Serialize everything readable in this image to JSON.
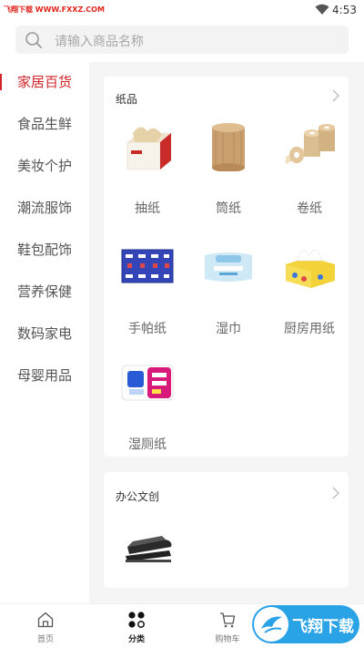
{
  "status_bar": {
    "watermark": "飞翔下载 WWW.FXXZ.COM",
    "time": "4:53"
  },
  "search": {
    "placeholder": "请输入商品名称"
  },
  "sidebar": {
    "items": [
      {
        "label": "家居百货",
        "active": true
      },
      {
        "label": "食品生鲜"
      },
      {
        "label": "美妆个护"
      },
      {
        "label": "潮流服饰"
      },
      {
        "label": "鞋包配饰"
      },
      {
        "label": "营养保健"
      },
      {
        "label": "数码家电"
      },
      {
        "label": "母婴用品"
      }
    ]
  },
  "sections": [
    {
      "title": "纸品",
      "items": [
        {
          "label": "抽纸",
          "icon": "tissue-box-icon"
        },
        {
          "label": "筒纸",
          "icon": "toilet-roll-icon"
        },
        {
          "label": "卷纸",
          "icon": "paper-rolls-icon"
        },
        {
          "label": "手帕纸",
          "icon": "pocket-tissue-pack-icon"
        },
        {
          "label": "湿巾",
          "icon": "wet-wipes-icon"
        },
        {
          "label": "厨房用纸",
          "icon": "kitchen-paper-icon"
        },
        {
          "label": "湿厕纸",
          "icon": "wet-toilet-paper-icon"
        }
      ]
    },
    {
      "title": "办公文创",
      "items": [
        {
          "label": "",
          "icon": "stapler-icon"
        }
      ]
    }
  ],
  "bottom_nav": {
    "items": [
      {
        "label": "首页",
        "icon": "home-icon"
      },
      {
        "label": "分类",
        "icon": "category-icon",
        "active": true
      },
      {
        "label": "购物车",
        "icon": "cart-icon"
      }
    ]
  },
  "badge": {
    "text": "飞翔下载"
  },
  "colors": {
    "accent": "#d0242a",
    "badge": "#2aa2e6"
  }
}
